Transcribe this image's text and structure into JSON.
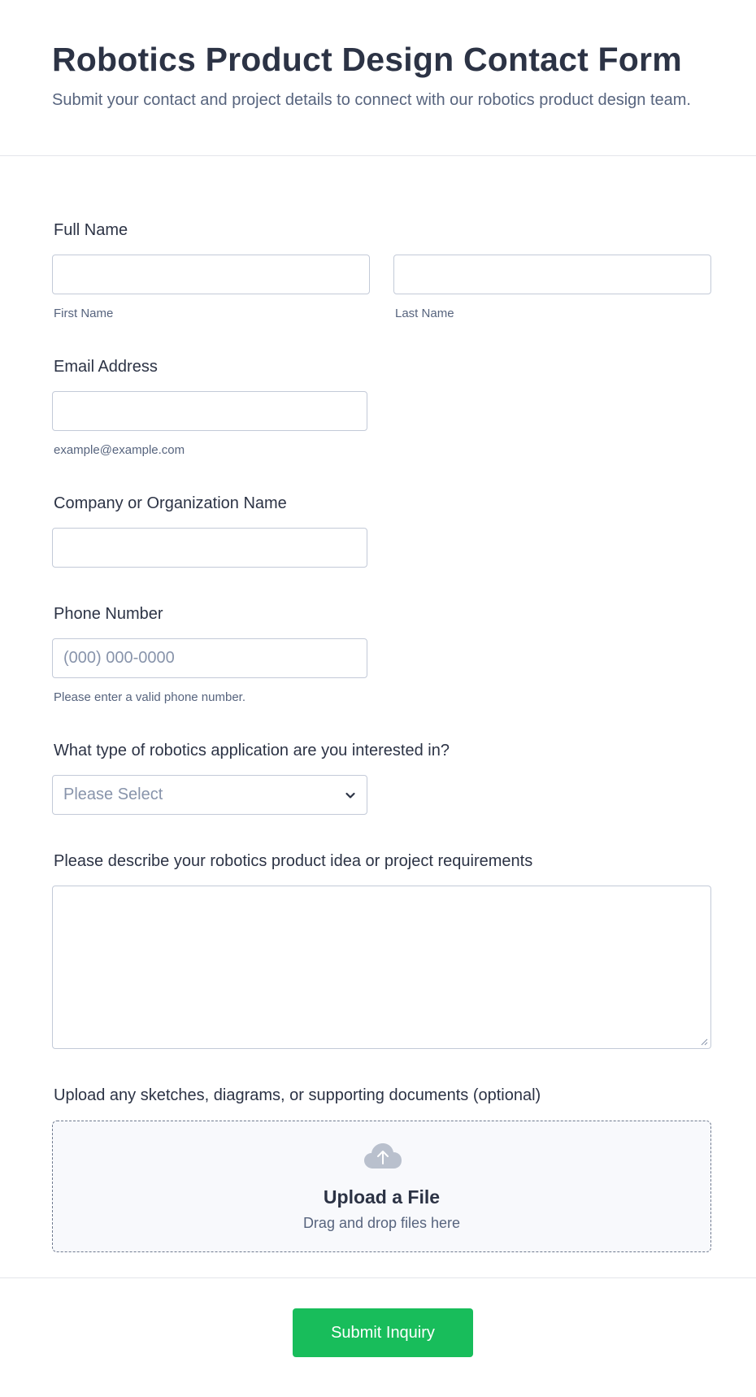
{
  "header": {
    "title": "Robotics Product Design Contact Form",
    "subtitle": "Submit your contact and project details to connect with our robotics product design team."
  },
  "fields": {
    "full_name": {
      "label": "Full Name",
      "first_sublabel": "First Name",
      "last_sublabel": "Last Name",
      "first_value": "",
      "last_value": ""
    },
    "email": {
      "label": "Email Address",
      "sublabel": "example@example.com",
      "value": ""
    },
    "company": {
      "label": "Company or Organization Name",
      "value": ""
    },
    "phone": {
      "label": "Phone Number",
      "placeholder": "(000) 000-0000",
      "sublabel": "Please enter a valid phone number."
    },
    "application_type": {
      "label": "What type of robotics application are you interested in?",
      "selected": "Please Select"
    },
    "description": {
      "label": "Please describe your robotics product idea or project requirements",
      "value": ""
    },
    "upload": {
      "label": "Upload any sketches, diagrams, or supporting documents (optional)",
      "title": "Upload a File",
      "subtitle": "Drag and drop files here",
      "icon": "cloud-upload-icon"
    }
  },
  "actions": {
    "submit_label": "Submit Inquiry"
  },
  "colors": {
    "accent": "#18bd5b",
    "text": "#2c3345",
    "muted": "#57647e",
    "border": "#c3cad8"
  }
}
